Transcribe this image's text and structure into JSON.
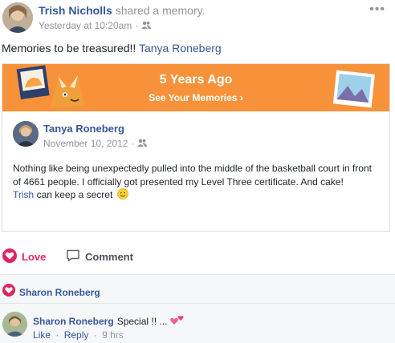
{
  "post": {
    "author": "Trish Nicholls",
    "action": "shared a memory.",
    "timestamp": "Yesterday at 10:20am",
    "audience_icon": "friends-icon",
    "more_icon": "more-options-icon",
    "text": "Memories to be treasured!!",
    "mention": "Tanya Roneberg"
  },
  "memory": {
    "banner_title": "5 Years Ago",
    "banner_link": "See Your Memories ›",
    "banner_color": "#f7923a",
    "author": "Tanya Roneberg",
    "date": "November 10, 2012",
    "body_line1": "Nothing like being unexpectedly pulled into the middle of the basketball court in front",
    "body_line2": "of 4661 people. I officially got presented my Level Three certificate. And cake!",
    "body_mention": "Trish",
    "body_line3": "can keep a secret"
  },
  "actions": {
    "love_label": "Love",
    "comment_label": "Comment",
    "love_color": "#e0245e"
  },
  "reactions": {
    "icon": "heart-icon",
    "name": "Sharon Roneberg"
  },
  "comment": {
    "author": "Sharon Roneberg",
    "text": "Special !! ...",
    "like": "Like",
    "reply": "Reply",
    "time": "9 hrs"
  }
}
